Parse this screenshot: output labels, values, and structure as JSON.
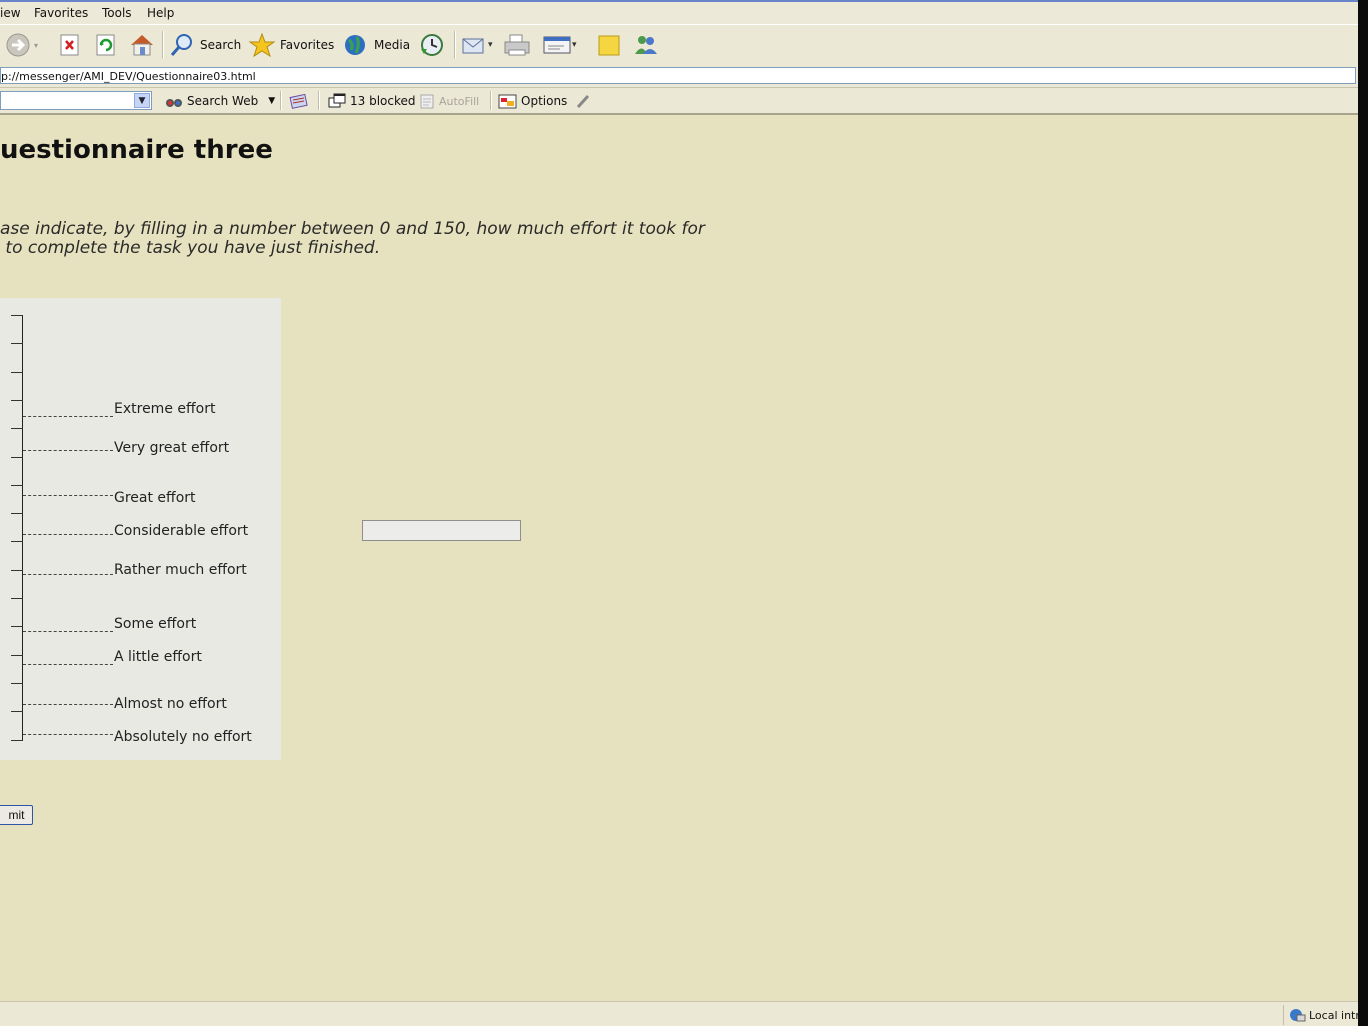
{
  "menu": [
    "iew",
    "Favorites",
    "Tools",
    "Help"
  ],
  "toolbar": {
    "search_label": "Search",
    "favorites_label": "Favorites",
    "media_label": "Media"
  },
  "address": {
    "url": "p://messenger/AMI_DEV/Questionnaire03.html"
  },
  "google_bar": {
    "search_web_label": "Search Web",
    "blocked_label": "13 blocked",
    "autofill_label": "AutoFill",
    "options_label": "Options"
  },
  "page": {
    "title": "uestionnaire three",
    "instruction": "ase indicate, by filling in a number between 0 and 150, how much effort it took for\n to complete the task you have just finished.",
    "scale_labels": [
      "Extreme effort",
      "Very great effort",
      "Great effort",
      "Considerable effort",
      "Rather much effort",
      "Some effort",
      "A little effort",
      "Almost no effort",
      "Absolutely no effort"
    ],
    "effort_value": "",
    "submit_label": "mit"
  },
  "status": {
    "zone_label": "Local intr"
  },
  "colors": {
    "page_bg": "#e6e2bf",
    "scale_bg": "#e9e9e4",
    "chrome_bg": "#ece8d6"
  }
}
